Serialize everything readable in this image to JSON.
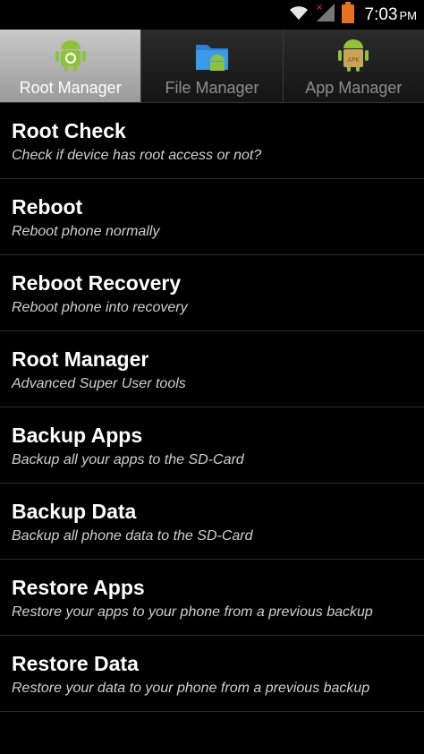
{
  "status_bar": {
    "time": "7:03",
    "ampm": "PM",
    "icons": [
      "wifi-icon",
      "signal-icon",
      "battery-icon"
    ],
    "battery_color": "#e8731e"
  },
  "tabs": [
    {
      "label": "Root Manager",
      "icon": "android-refresh-icon",
      "active": true
    },
    {
      "label": "File Manager",
      "icon": "folder-android-icon",
      "active": false
    },
    {
      "label": "App Manager",
      "icon": "apk-android-icon",
      "active": false
    }
  ],
  "items": [
    {
      "title": "Root Check",
      "subtitle": "Check if device has root access or not?"
    },
    {
      "title": "Reboot",
      "subtitle": "Reboot phone normally"
    },
    {
      "title": "Reboot Recovery",
      "subtitle": "Reboot phone into recovery"
    },
    {
      "title": "Root Manager",
      "subtitle": "Advanced Super User tools"
    },
    {
      "title": "Backup Apps",
      "subtitle": "Backup all your apps to the SD-Card"
    },
    {
      "title": "Backup Data",
      "subtitle": "Backup all phone data to the SD-Card"
    },
    {
      "title": "Restore Apps",
      "subtitle": "Restore your apps to your phone from a previous backup"
    },
    {
      "title": "Restore Data",
      "subtitle": "Restore your data to your phone from a previous backup"
    }
  ],
  "colors": {
    "android_green": "#8fc23b",
    "tab_active_bg": "#b5b5b5",
    "background": "#000000"
  }
}
